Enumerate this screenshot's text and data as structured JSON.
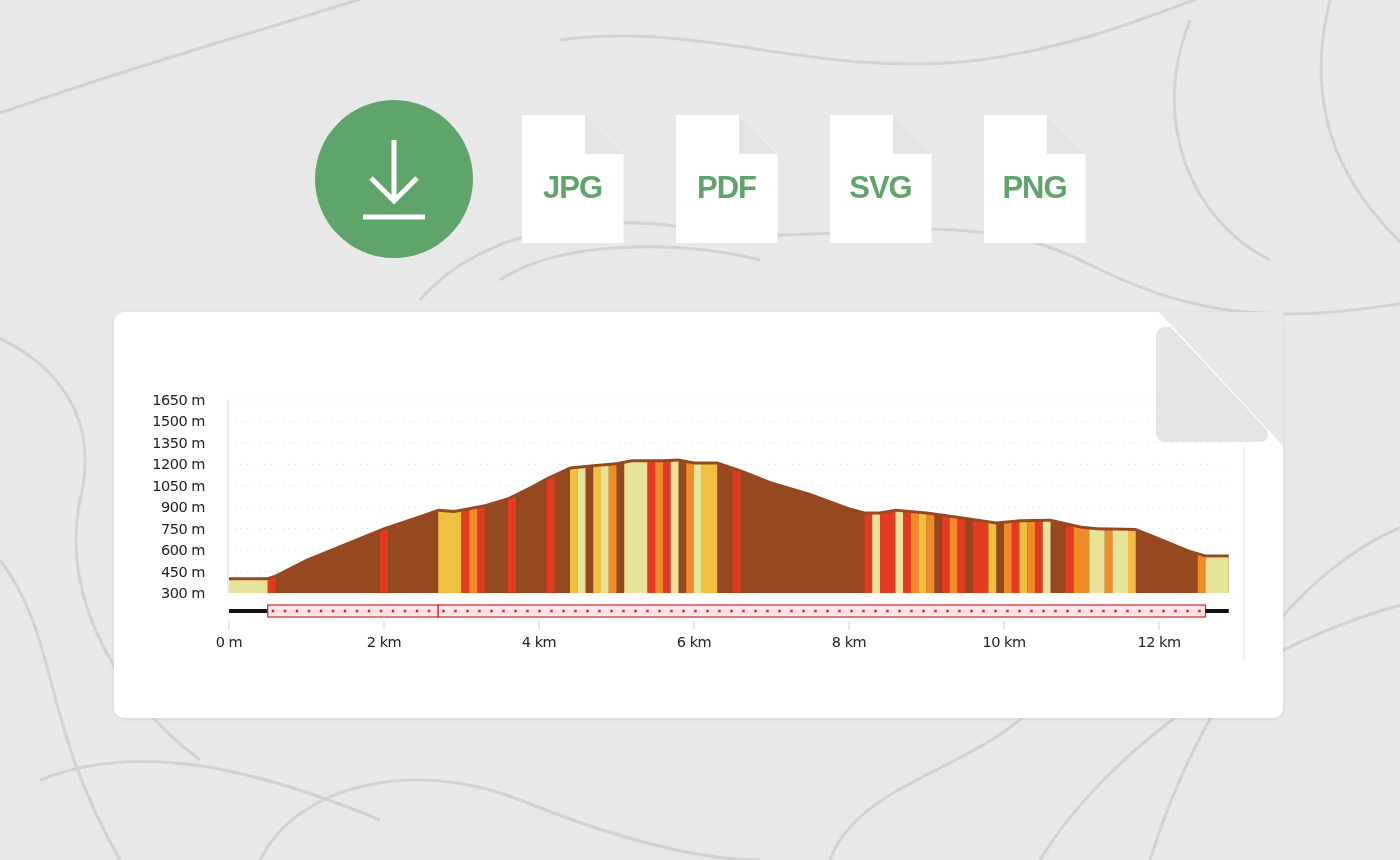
{
  "export_formats": [
    {
      "label": "JPG"
    },
    {
      "label": "PDF"
    },
    {
      "label": "SVG"
    },
    {
      "label": "PNG"
    }
  ],
  "elevation_profile": {
    "chart_data": {
      "type": "area",
      "xlim": [
        0,
        12.9
      ],
      "ylim": [
        300,
        1650
      ],
      "grid": true,
      "xticks": [
        {
          "value": 0,
          "label": "0 m"
        },
        {
          "value": 2,
          "label": "2 km"
        },
        {
          "value": 4,
          "label": "4 km"
        },
        {
          "value": 6,
          "label": "6 km"
        },
        {
          "value": 8,
          "label": "8 km"
        },
        {
          "value": 10,
          "label": "10 km"
        },
        {
          "value": 12,
          "label": "12 km"
        }
      ],
      "yticks": [
        {
          "value": 300,
          "label": "300 m"
        },
        {
          "value": 450,
          "label": "450 m"
        },
        {
          "value": 600,
          "label": "600 m"
        },
        {
          "value": 750,
          "label": "750 m"
        },
        {
          "value": 900,
          "label": "900 m"
        },
        {
          "value": 1050,
          "label": "1050 m"
        },
        {
          "value": 1200,
          "label": "1200 m"
        },
        {
          "value": 1350,
          "label": "1350 m"
        },
        {
          "value": 1500,
          "label": "1500 m"
        },
        {
          "value": 1650,
          "label": "1650 m"
        }
      ],
      "x": [
        0,
        0.5,
        0.6,
        1.0,
        1.5,
        2.0,
        2.5,
        2.7,
        2.9,
        3.3,
        3.6,
        3.9,
        4.1,
        4.4,
        4.7,
        5.0,
        5.2,
        5.6,
        5.8,
        6.0,
        6.3,
        6.6,
        7.0,
        7.5,
        8.0,
        8.2,
        8.4,
        8.6,
        9.0,
        9.4,
        9.9,
        10.2,
        10.6,
        11.0,
        11.2,
        11.7,
        12.0,
        12.4,
        12.6,
        12.9
      ],
      "series": [
        {
          "color": "#964820",
          "values": [
            410,
            410,
            430,
            540,
            650,
            760,
            850,
            890,
            880,
            920,
            970,
            1050,
            1110,
            1185,
            1200,
            1215,
            1235,
            1235,
            1240,
            1220,
            1220,
            1165,
            1080,
            1000,
            900,
            870,
            870,
            890,
            870,
            840,
            800,
            815,
            820,
            770,
            760,
            755,
            690,
            600,
            570,
            570
          ]
        }
      ],
      "bands": [
        {
          "axis": "x",
          "from": 0,
          "to": 0.5,
          "color": "#e6e49a"
        },
        {
          "axis": "x",
          "from": 0.5,
          "to": 0.6,
          "color": "#e53a22"
        },
        {
          "axis": "x",
          "from": 1.95,
          "to": 2.05,
          "color": "#e53a22"
        },
        {
          "axis": "x",
          "from": 2.7,
          "to": 3.0,
          "color": "#f0c040"
        },
        {
          "axis": "x",
          "from": 3.0,
          "to": 3.1,
          "color": "#e53a22"
        },
        {
          "axis": "x",
          "from": 3.1,
          "to": 3.2,
          "color": "#ef8c2a"
        },
        {
          "axis": "x",
          "from": 3.2,
          "to": 3.3,
          "color": "#e53a22"
        },
        {
          "axis": "x",
          "from": 3.6,
          "to": 3.7,
          "color": "#e53a22"
        },
        {
          "axis": "x",
          "from": 4.1,
          "to": 4.2,
          "color": "#e53a22"
        },
        {
          "axis": "x",
          "from": 4.4,
          "to": 4.5,
          "color": "#f0c040"
        },
        {
          "axis": "x",
          "from": 4.5,
          "to": 4.6,
          "color": "#e6e49a"
        },
        {
          "axis": "x",
          "from": 4.7,
          "to": 4.8,
          "color": "#f0c040"
        },
        {
          "axis": "x",
          "from": 4.8,
          "to": 4.9,
          "color": "#e6e49a"
        },
        {
          "axis": "x",
          "from": 4.9,
          "to": 5.0,
          "color": "#ef8c2a"
        },
        {
          "axis": "x",
          "from": 5.1,
          "to": 5.4,
          "color": "#e6e49a"
        },
        {
          "axis": "x",
          "from": 5.4,
          "to": 5.5,
          "color": "#e53a22"
        },
        {
          "axis": "x",
          "from": 5.5,
          "to": 5.6,
          "color": "#ef8c2a"
        },
        {
          "axis": "x",
          "from": 5.6,
          "to": 5.7,
          "color": "#e53a22"
        },
        {
          "axis": "x",
          "from": 5.7,
          "to": 5.8,
          "color": "#e6e49a"
        },
        {
          "axis": "x",
          "from": 5.9,
          "to": 6.0,
          "color": "#ef8c2a"
        },
        {
          "axis": "x",
          "from": 6.0,
          "to": 6.1,
          "color": "#e6e49a"
        },
        {
          "axis": "x",
          "from": 6.1,
          "to": 6.3,
          "color": "#f0c040"
        },
        {
          "axis": "x",
          "from": 6.5,
          "to": 6.6,
          "color": "#e53a22"
        },
        {
          "axis": "x",
          "from": 8.2,
          "to": 8.3,
          "color": "#e53a22"
        },
        {
          "axis": "x",
          "from": 8.3,
          "to": 8.4,
          "color": "#e6e49a"
        },
        {
          "axis": "x",
          "from": 8.4,
          "to": 8.6,
          "color": "#e53a22"
        },
        {
          "axis": "x",
          "from": 8.6,
          "to": 8.7,
          "color": "#e6e49a"
        },
        {
          "axis": "x",
          "from": 8.7,
          "to": 8.8,
          "color": "#e53a22"
        },
        {
          "axis": "x",
          "from": 8.8,
          "to": 8.9,
          "color": "#ef8c2a"
        },
        {
          "axis": "x",
          "from": 8.9,
          "to": 9.0,
          "color": "#f0c040"
        },
        {
          "axis": "x",
          "from": 9.0,
          "to": 9.1,
          "color": "#ef8c2a"
        },
        {
          "axis": "x",
          "from": 9.2,
          "to": 9.3,
          "color": "#e53a22"
        },
        {
          "axis": "x",
          "from": 9.3,
          "to": 9.4,
          "color": "#ef8c2a"
        },
        {
          "axis": "x",
          "from": 9.4,
          "to": 9.5,
          "color": "#e53a22"
        },
        {
          "axis": "x",
          "from": 9.6,
          "to": 9.8,
          "color": "#e53a22"
        },
        {
          "axis": "x",
          "from": 9.8,
          "to": 9.9,
          "color": "#f0c040"
        },
        {
          "axis": "x",
          "from": 10.0,
          "to": 10.1,
          "color": "#ef8c2a"
        },
        {
          "axis": "x",
          "from": 10.1,
          "to": 10.2,
          "color": "#e53a22"
        },
        {
          "axis": "x",
          "from": 10.2,
          "to": 10.3,
          "color": "#f0c040"
        },
        {
          "axis": "x",
          "from": 10.3,
          "to": 10.4,
          "color": "#ef8c2a"
        },
        {
          "axis": "x",
          "from": 10.4,
          "to": 10.5,
          "color": "#e53a22"
        },
        {
          "axis": "x",
          "from": 10.5,
          "to": 10.6,
          "color": "#e6e49a"
        },
        {
          "axis": "x",
          "from": 10.8,
          "to": 10.9,
          "color": "#e53a22"
        },
        {
          "axis": "x",
          "from": 10.9,
          "to": 11.1,
          "color": "#ef8c2a"
        },
        {
          "axis": "x",
          "from": 11.1,
          "to": 11.3,
          "color": "#e6e49a"
        },
        {
          "axis": "x",
          "from": 11.3,
          "to": 11.4,
          "color": "#ef8c2a"
        },
        {
          "axis": "x",
          "from": 11.4,
          "to": 11.6,
          "color": "#e6e49a"
        },
        {
          "axis": "x",
          "from": 11.6,
          "to": 11.7,
          "color": "#f0c040"
        },
        {
          "axis": "x",
          "from": 12.5,
          "to": 12.6,
          "color": "#ef8c2a"
        },
        {
          "axis": "x",
          "from": 12.6,
          "to": 12.9,
          "color": "#e6e49a"
        }
      ]
    },
    "track": [
      {
        "kind": "road"
      },
      {
        "kind": "trail"
      },
      {
        "kind": "trail"
      },
      {
        "kind": "road"
      }
    ]
  }
}
